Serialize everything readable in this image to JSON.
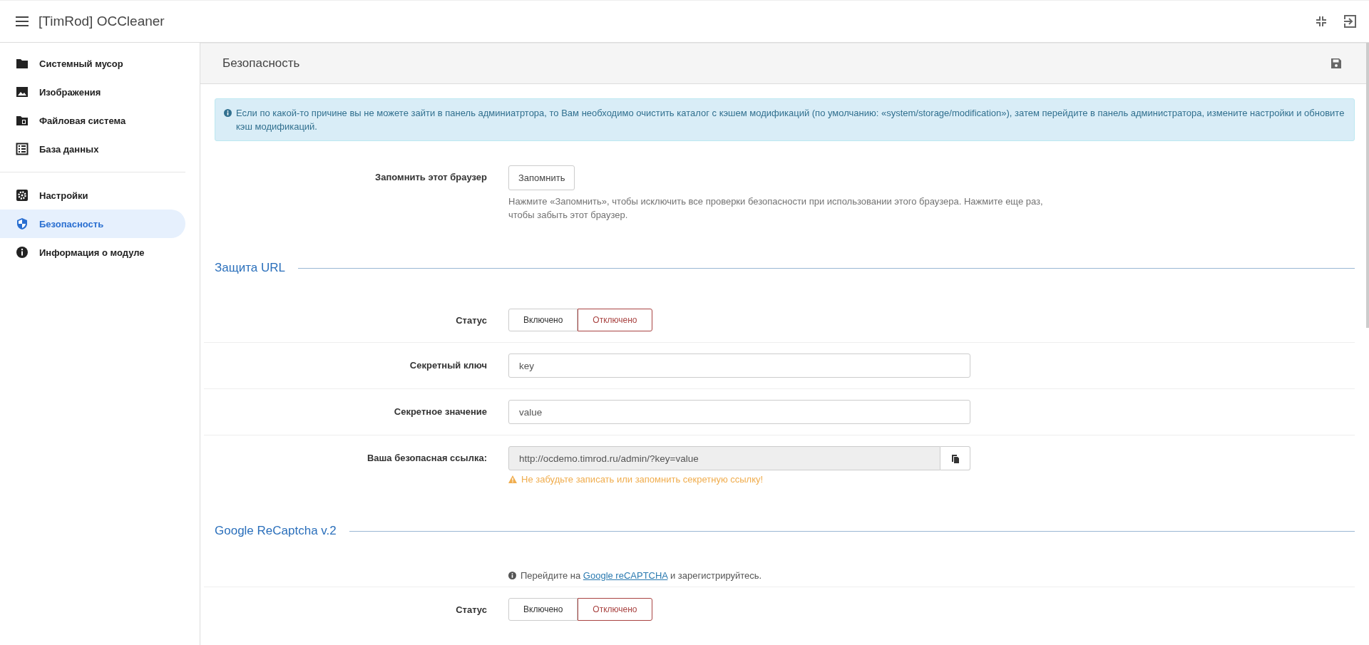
{
  "app": {
    "title": "[TimRod] OCCleaner"
  },
  "sidebar": {
    "groups": [
      [
        {
          "label": "Системный мусор",
          "selected": false
        },
        {
          "label": "Изображения",
          "selected": false
        },
        {
          "label": "Файловая система",
          "selected": false
        },
        {
          "label": "База данных",
          "selected": false
        }
      ],
      [
        {
          "label": "Настройки",
          "selected": false
        },
        {
          "label": "Безопасность",
          "selected": true
        },
        {
          "label": "Информация о модуле",
          "selected": false
        }
      ]
    ]
  },
  "panel": {
    "title": "Безопасность"
  },
  "alert": {
    "text": "Если по какой-то причине вы не можете зайти в панель админиатртора, то Вам необходимо очистить каталог с кэшем модификаций (по умолчанию: «system/storage/modification»), затем перейдите в панель администратора, измените настройки и обновите кэш модификаций."
  },
  "rows": [
    {
      "kind": "remember",
      "label": "Запомнить этот браузер",
      "button": "Запомнить",
      "help": "Нажмите «Запомнить», чтобы исключить все проверки безопасности при использовании этого браузера. Нажмите еще раз, чтобы забыть этот браузер."
    },
    {
      "kind": "heading",
      "label": "Защита URL"
    },
    {
      "kind": "toggle",
      "label": "Статус",
      "options": [
        {
          "label": "Включено",
          "selected": false
        },
        {
          "label": "Отключено",
          "selected": true
        }
      ]
    },
    {
      "kind": "input",
      "label": "Секретный ключ",
      "value": "key"
    },
    {
      "kind": "input",
      "label": "Секретное значение",
      "value": "value"
    },
    {
      "kind": "copy",
      "label": "Ваша безопасная ссылка:",
      "value": "http://ocdemo.timrod.ru/admin/?key=value",
      "warning": "Не забудьте записать или запомнить секретную ссылку!"
    },
    {
      "kind": "heading",
      "label": "Google ReCaptcha v.2"
    },
    {
      "kind": "note",
      "before": "Перейдите на",
      "link": "Google reCAPTCHA",
      "after": "и зарегистрируйтесь."
    },
    {
      "kind": "toggle",
      "label": "Статус",
      "options": [
        {
          "label": "Включено",
          "selected": false
        },
        {
          "label": "Отключено",
          "selected": true
        }
      ]
    }
  ]
}
